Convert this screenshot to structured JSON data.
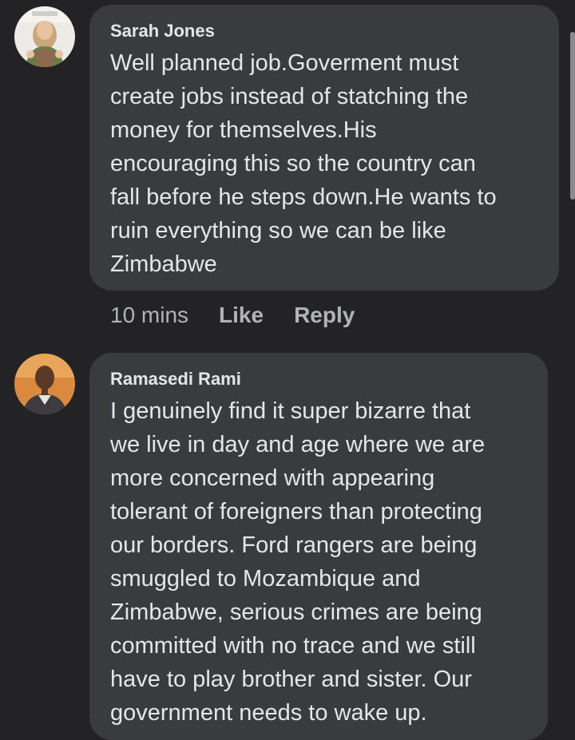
{
  "comments": [
    {
      "author": "Sarah Jones",
      "avatar_icon": "profile-photo-woman",
      "text": "Well planned job.Goverment must\ncreate jobs instead of statching the\nmoney for themselves.His\nencouraging this so the country can\nfall before he steps down.He wants to\nruin everything so we can be like\nZimbabwe",
      "time": "10 mins",
      "like_label": "Like",
      "reply_label": "Reply"
    },
    {
      "author": "Ramasedi Rami",
      "avatar_icon": "profile-photo-man",
      "text": "I genuinely find it super bizarre that\nwe live in day and age where we are\nmore concerned with appearing\ntolerant of foreigners than protecting\nour borders. Ford rangers are being\nsmuggled to Mozambique and\nZimbabwe, serious crimes are being\ncommitted with no trace and we still\nhave to play brother and sister. Our\ngovernment needs to wake up."
    }
  ],
  "colors": {
    "background": "#232325",
    "bubble": "#3a3b3c",
    "text": "#e4e6eb",
    "meta_text": "#b0b3b8"
  }
}
